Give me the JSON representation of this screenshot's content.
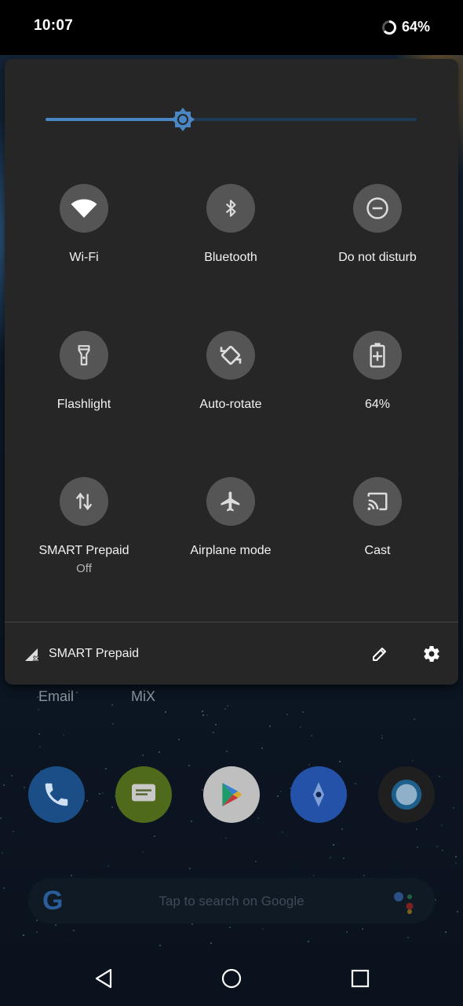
{
  "status_bar": {
    "time": "10:07",
    "battery": "64%"
  },
  "quick_settings": {
    "brightness_level": 0.37,
    "tiles": [
      {
        "id": "wifi",
        "label": "Wi-Fi",
        "icon": "wifi-icon"
      },
      {
        "id": "bluetooth",
        "label": "Bluetooth",
        "icon": "bluetooth-icon"
      },
      {
        "id": "dnd",
        "label": "Do not disturb",
        "icon": "do-not-disturb-icon"
      },
      {
        "id": "flashlight",
        "label": "Flashlight",
        "icon": "flashlight-icon"
      },
      {
        "id": "autorotate",
        "label": "Auto-rotate",
        "icon": "auto-rotate-icon"
      },
      {
        "id": "battery",
        "label": "64%",
        "icon": "battery-plus-icon"
      },
      {
        "id": "mobile-data",
        "label": "SMART Prepaid",
        "sublabel": "Off",
        "icon": "mobile-data-icon"
      },
      {
        "id": "airplane",
        "label": "Airplane mode",
        "icon": "airplane-icon"
      },
      {
        "id": "cast",
        "label": "Cast",
        "icon": "cast-icon"
      }
    ],
    "footer": {
      "carrier": "SMART Prepaid"
    }
  },
  "home_screen": {
    "labels": [
      "Email",
      "MiX"
    ],
    "dock": [
      "phone-icon",
      "messages-icon",
      "play-store-icon",
      "maps-icon",
      "camera-icon"
    ],
    "search_placeholder": "Tap to search on Google"
  },
  "colors": {
    "accent": "#4b86c4",
    "panel": "#262626",
    "tile_circle": "#555555"
  }
}
